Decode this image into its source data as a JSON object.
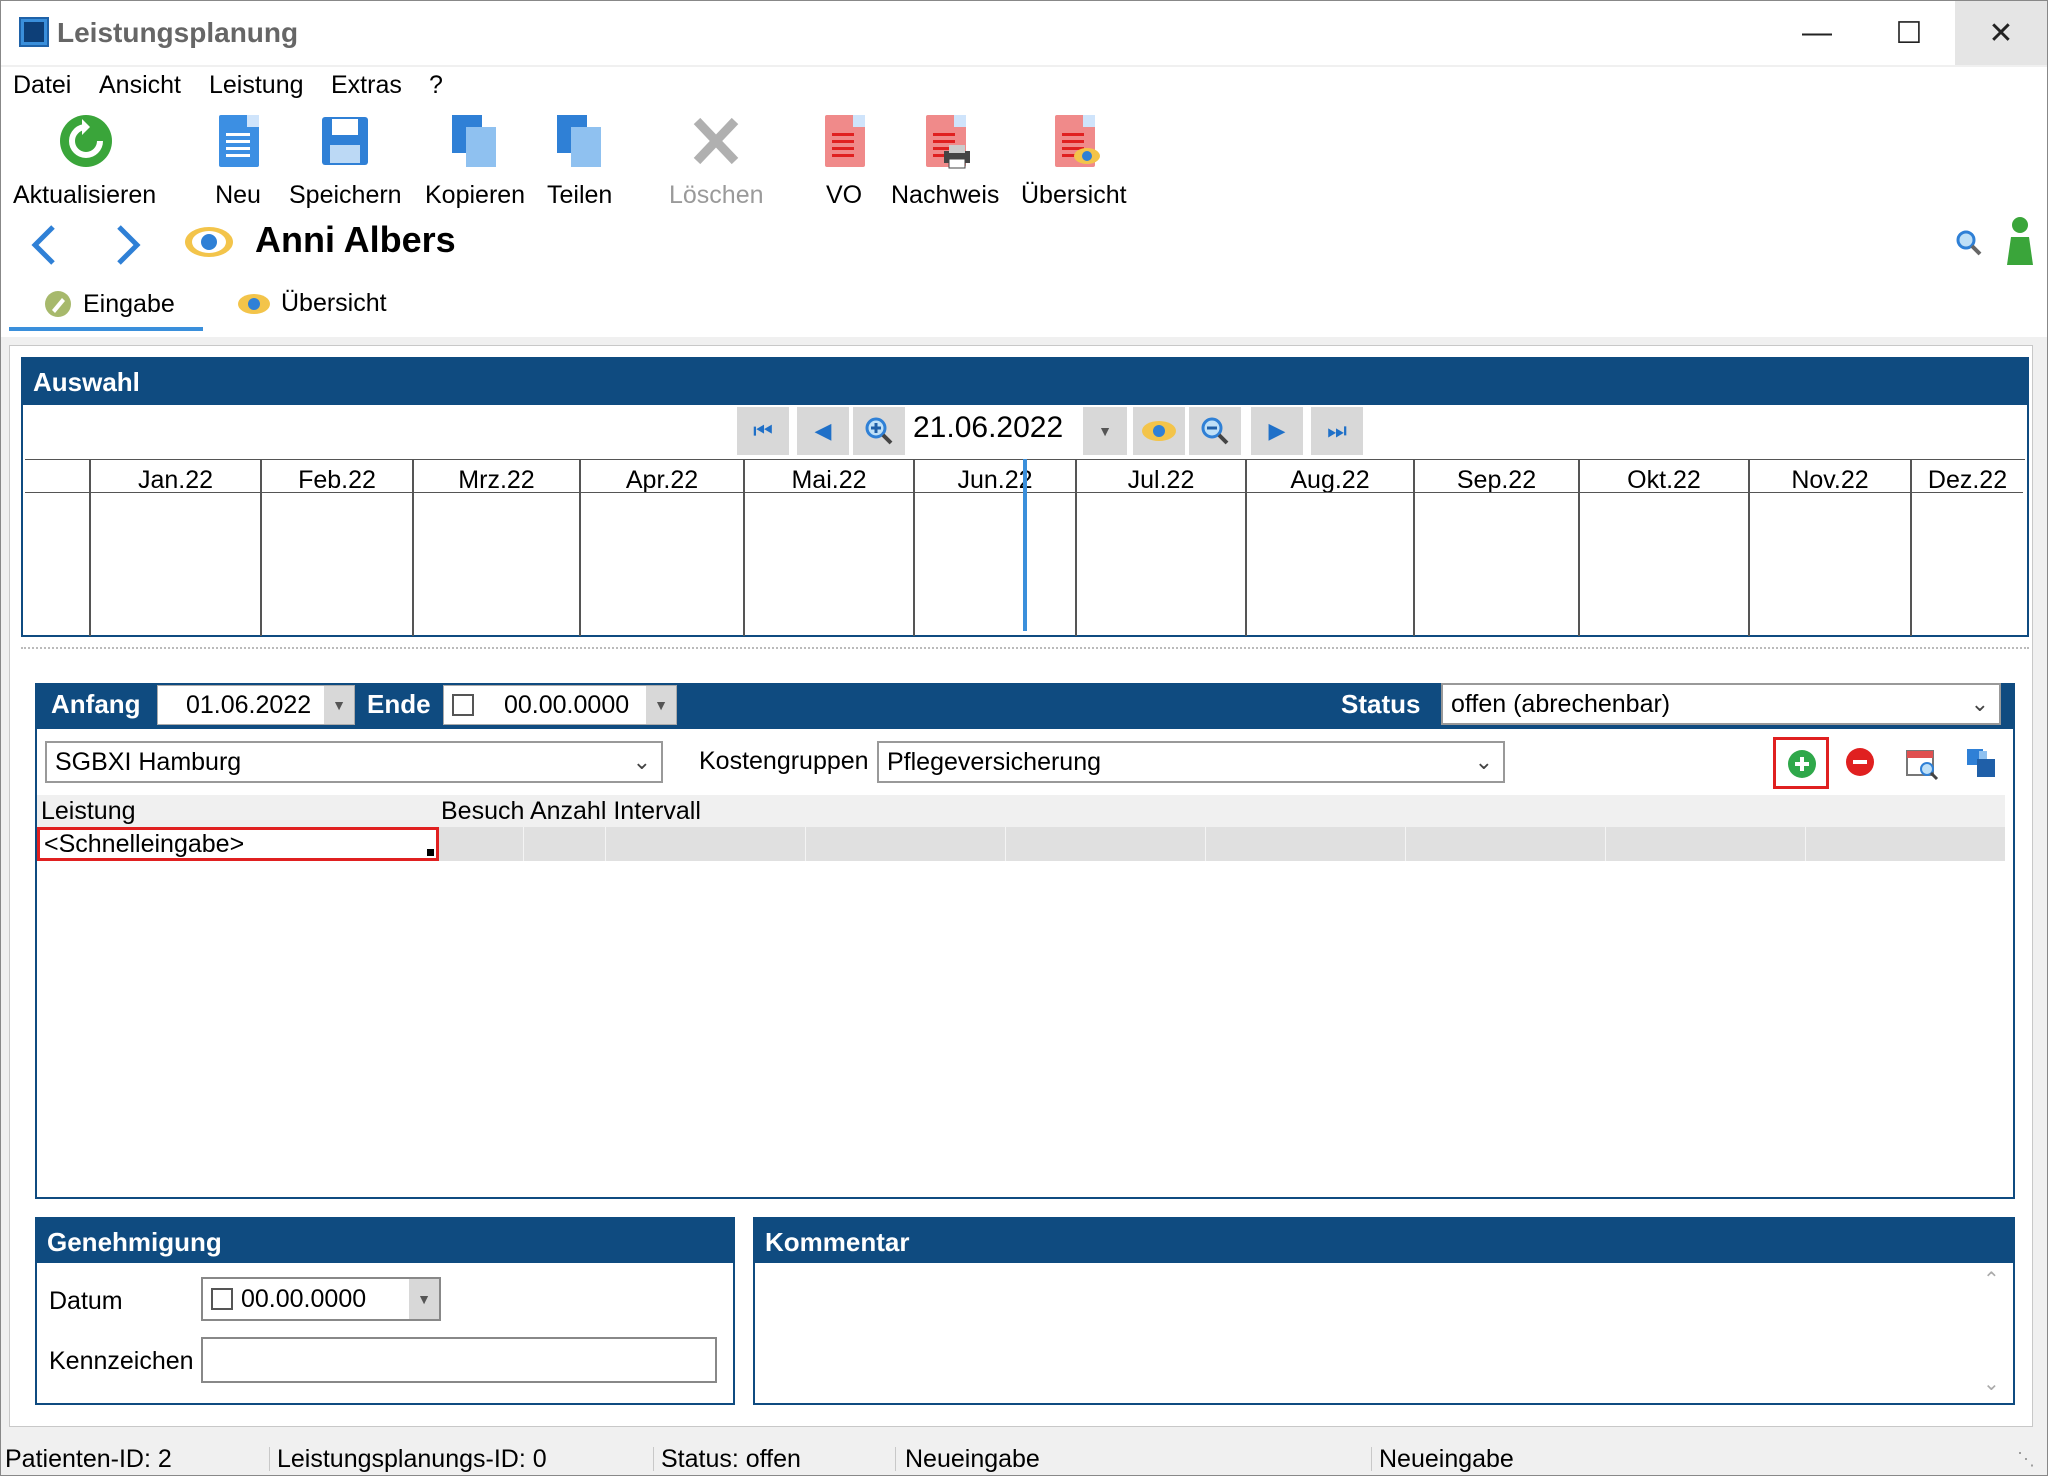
{
  "window": {
    "title": "Leistungsplanung"
  },
  "menu": [
    "Datei",
    "Ansicht",
    "Leistung",
    "Extras",
    "?"
  ],
  "toolbar": {
    "refresh": "Aktualisieren",
    "new": "Neu",
    "save": "Speichern",
    "copy": "Kopieren",
    "split": "Teilen",
    "delete": "Löschen",
    "vo": "VO",
    "proof": "Nachweis",
    "overview": "Übersicht"
  },
  "patient": {
    "name": "Anni Albers"
  },
  "tabs": {
    "input": "Eingabe",
    "overview": "Übersicht"
  },
  "auswahl": {
    "title": "Auswahl",
    "date": "21.06.2022",
    "months": [
      "Jan.22",
      "Feb.22",
      "Mrz.22",
      "Apr.22",
      "Mai.22",
      "Jun.22",
      "Jul.22",
      "Aug.22",
      "Sep.22",
      "Okt.22",
      "Nov.22",
      "Dez.22"
    ]
  },
  "detail": {
    "start_label": "Anfang",
    "start_value": "01.06.2022",
    "end_label": "Ende",
    "end_value": "00.00.0000",
    "status_label": "Status",
    "status_value": "offen (abrechenbar)",
    "fund": "SGBXI Hamburg",
    "cost_groups_label": "Kostengruppen",
    "cost_groups_value": "Pflegeversicherung",
    "columns": {
      "service": "Leistung",
      "visit_count_interval": "Besuch Anzahl Intervall"
    },
    "quick_entry": "<Schnelleingabe>"
  },
  "approval": {
    "title": "Genehmigung",
    "date_label": "Datum",
    "date_value": "00.00.0000",
    "mark_label": "Kennzeichen",
    "mark_value": ""
  },
  "comment": {
    "title": "Kommentar"
  },
  "statusbar": {
    "patient_id": "Patienten-ID: 2",
    "plan_id": "Leistungsplanungs-ID: 0",
    "status": "Status: offen",
    "mode1": "Neueingabe",
    "mode2": "Neueingabe"
  },
  "colors": {
    "header_blue": "#0f4b80",
    "highlight_red": "#e02020",
    "accent_blue": "#3a8fdb"
  }
}
